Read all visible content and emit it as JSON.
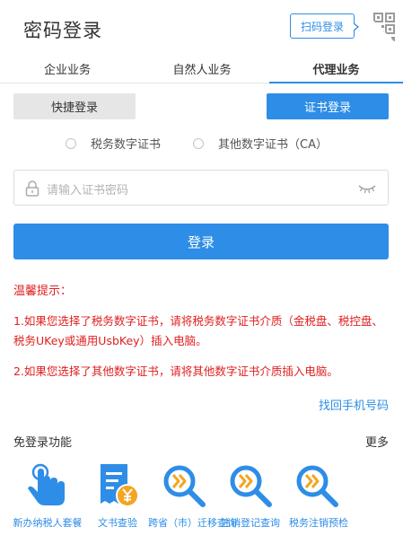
{
  "header": {
    "title": "密码登录",
    "qr_login_label": "扫码登录"
  },
  "tabs": [
    {
      "label": "企业业务",
      "active": false
    },
    {
      "label": "自然人业务",
      "active": false
    },
    {
      "label": "代理业务",
      "active": true
    }
  ],
  "login_modes": {
    "quick_label": "快捷登录",
    "cert_label": "证书登录",
    "selected": "证书登录"
  },
  "cert_types": [
    {
      "label": "税务数字证书",
      "checked": false
    },
    {
      "label": "其他数字证书（CA）",
      "checked": false
    }
  ],
  "password": {
    "placeholder": "请输入证书密码",
    "value": ""
  },
  "login_button": "登录",
  "tips": {
    "title": "温馨提示：",
    "items": [
      "1.如果您选择了税务数字证书，请将税务数字证书介质（金税盘、税控盘、税务UKey或通用UsbKey）插入电脑。",
      "2.如果您选择了其他数字证书，请将其他数字证书介质插入电脑。"
    ]
  },
  "recover_phone_link": "找回手机号码",
  "functions": {
    "title": "免登录功能",
    "more": "更多",
    "items": [
      {
        "label": "新办纳税人套餐",
        "icon": "hand-touch-icon"
      },
      {
        "label": "文书查验",
        "icon": "document-yuan-icon"
      },
      {
        "label": "跨省（市）迁移查询",
        "icon": "search-forward-icon"
      },
      {
        "label": "注销登记查询",
        "icon": "search-forward-icon"
      },
      {
        "label": "税务注销预检",
        "icon": "search-forward-icon"
      }
    ]
  },
  "colors": {
    "accent": "#2e8de6",
    "warning": "#e02020"
  }
}
